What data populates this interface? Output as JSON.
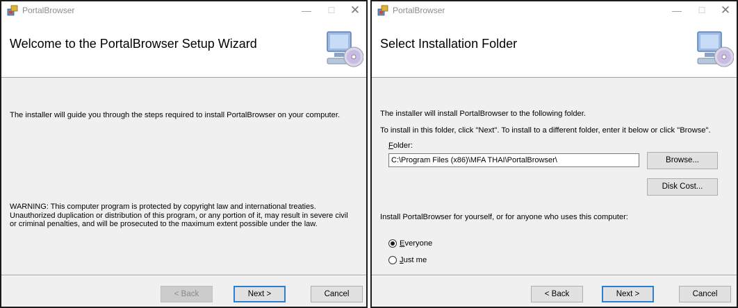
{
  "left_window": {
    "title": "PortalBrowser",
    "header_title": "Welcome to the PortalBrowser Setup Wizard",
    "intro": "The installer will guide you through the steps required to install PortalBrowser on your computer.",
    "warning_lines": [
      "WARNING: This computer program is protected by copyright law and international treaties.",
      "Unauthorized duplication or distribution of this program, or any portion of it, may result in severe civil",
      "or criminal penalties, and will be prosecuted to the maximum extent possible under the law."
    ],
    "back_label": "< Back",
    "next_label": "Next >",
    "cancel_label": "Cancel"
  },
  "right_window": {
    "title": "PortalBrowser",
    "header_title": "Select Installation Folder",
    "line1": "The installer will install PortalBrowser to the following folder.",
    "line2": "To install in this folder, click \"Next\". To install to a different folder, enter it below or click \"Browse\".",
    "folder_label_accel": "F",
    "folder_label_rest": "older:",
    "folder_value": "C:\\Program Files (x86)\\MFA THAI\\PortalBrowser\\",
    "browse_label": "Browse...",
    "disk_cost_label": "Disk Cost...",
    "scope_prompt": "Install PortalBrowser for yourself, or for anyone who uses this computer:",
    "option_everyone_accel": "E",
    "option_everyone_rest": "veryone",
    "option_justme_accel": "J",
    "option_justme_rest": "ust me",
    "selected_option": "Everyone",
    "back_label": "< Back",
    "next_label": "Next >",
    "cancel_label": "Cancel"
  },
  "icons": {
    "app": "installer-package-icon",
    "header_art": "computer-with-disc-icon",
    "minimize": "minimize-icon",
    "maximize": "maximize-icon",
    "close": "close-icon"
  },
  "colors": {
    "dialog_bg": "#f0f0f0",
    "header_bg": "#ffffff",
    "default_button_border": "#2a7fd4"
  }
}
